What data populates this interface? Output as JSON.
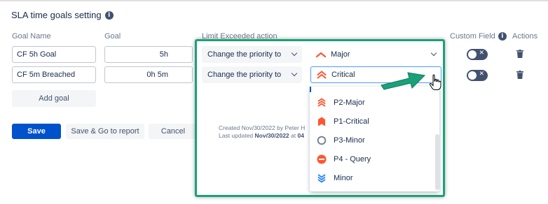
{
  "page": {
    "title": "SLA time goals setting"
  },
  "headers": {
    "goal_name": "Goal Name",
    "goal": "Goal",
    "limit_action": "Limit Exceeded action",
    "custom_field": "Custom Field",
    "actions": "Actions"
  },
  "goals": [
    {
      "name": "CF 5h Goal",
      "goal": "5h",
      "action": "Change the priority to",
      "priority": "Major",
      "priority_icon": "major-priority-icon"
    },
    {
      "name": "CF 5m Breached",
      "goal": "0h 5m",
      "action": "Change the priority to",
      "priority": "Critical",
      "priority_icon": "critical-priority-icon"
    }
  ],
  "buttons": {
    "add_goal": "Add goal",
    "save": "Save",
    "save_go_report": "Save & Go to report",
    "cancel": "Cancel"
  },
  "meta": {
    "created_prefix": "Created Nov/30/2022 by Peter H",
    "updated_prefix": "Last updated ",
    "updated_date": "Nov/30/2022",
    "updated_mid": " at ",
    "updated_time": "04"
  },
  "dropdown": {
    "options": [
      {
        "label": "P2-Major",
        "icon": "p2-major-icon"
      },
      {
        "label": "P1-Critical",
        "icon": "p1-critical-icon"
      },
      {
        "label": "P3-Minor",
        "icon": "p3-minor-icon"
      },
      {
        "label": "P4 - Query",
        "icon": "p4-query-icon"
      },
      {
        "label": "Minor",
        "icon": "minor-priority-icon"
      }
    ]
  },
  "colors": {
    "primary": "#0052cc",
    "highlight": "#1aa179",
    "priority_orange": "#ff5630",
    "minor_blue": "#2684ff"
  }
}
